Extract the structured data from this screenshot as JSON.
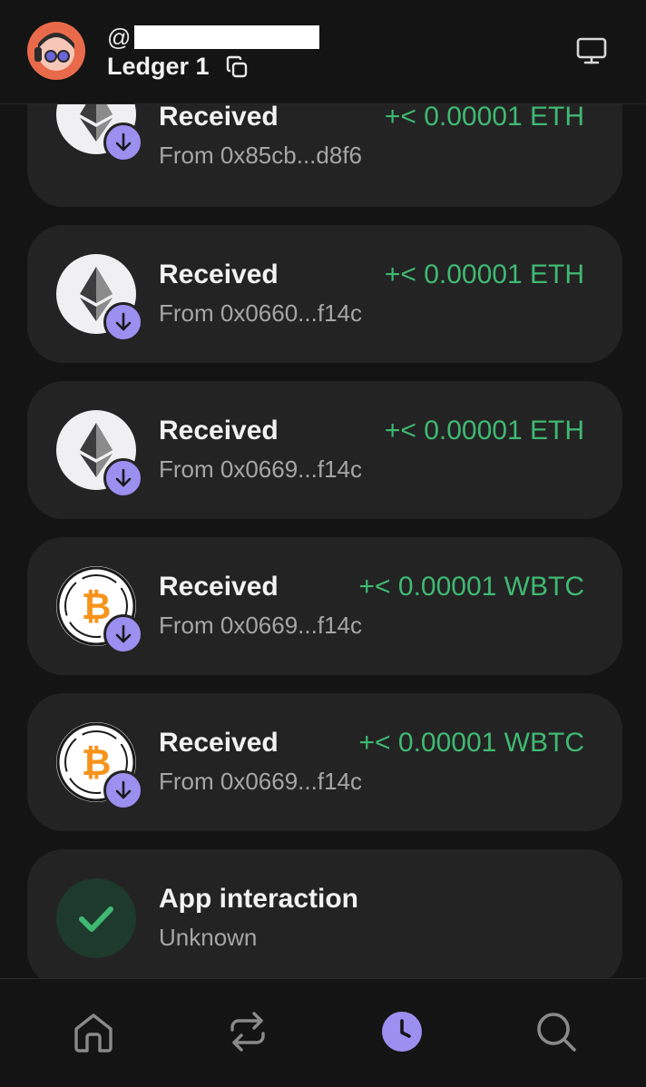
{
  "header": {
    "handle_prefix": "@",
    "account_name": "Ledger 1",
    "icons": [
      "avatar",
      "copy-icon",
      "desktop-icon"
    ]
  },
  "transactions": [
    {
      "title": "Received",
      "from": "From 0x85cb...d8f6",
      "amount": "+< 0.00001 ETH",
      "asset": "eth-icon",
      "badge": "arrow-down-icon"
    },
    {
      "title": "Received",
      "from": "From 0x0660...f14c",
      "amount": "+< 0.00001 ETH",
      "asset": "eth-icon",
      "badge": "arrow-down-icon"
    },
    {
      "title": "Received",
      "from": "From 0x0669...f14c",
      "amount": "+< 0.00001 ETH",
      "asset": "eth-icon",
      "badge": "arrow-down-icon"
    },
    {
      "title": "Received",
      "from": "From 0x0669...f14c",
      "amount": "+< 0.00001 WBTC",
      "asset": "wbtc-icon",
      "badge": "arrow-down-icon"
    },
    {
      "title": "Received",
      "from": "From 0x0669...f14c",
      "amount": "+< 0.00001 WBTC",
      "asset": "wbtc-icon",
      "badge": "arrow-down-icon"
    },
    {
      "title": "App interaction",
      "from": "Unknown",
      "amount": "",
      "asset": "check-icon",
      "badge": ""
    }
  ],
  "tabs": [
    {
      "name": "home-icon",
      "active": false
    },
    {
      "name": "swap-icon",
      "active": false
    },
    {
      "name": "activity-clock-icon",
      "active": true
    },
    {
      "name": "search-icon",
      "active": false
    }
  ],
  "colors": {
    "background": "#141414",
    "card": "#232323",
    "amount_green": "#3fb972",
    "accent_purple": "#9b8ff0",
    "avatar_orange": "#e96a4a",
    "bitcoin_orange": "#f7931a"
  }
}
